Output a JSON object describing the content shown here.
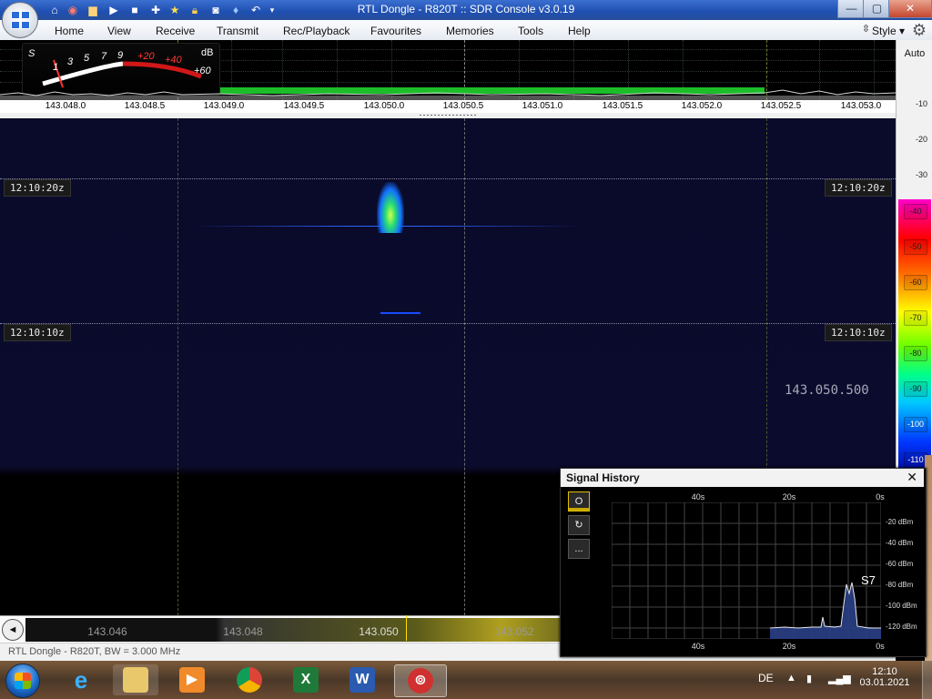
{
  "window": {
    "title": "RTL Dongle - R820T :: SDR Console v3.0.19",
    "min": "—",
    "max": "▢",
    "close": "✕"
  },
  "quick_access": [
    "home-icon",
    "lifebuoy-icon",
    "folder-icon",
    "play-icon",
    "stop-icon",
    "plus-icon",
    "star-icon",
    "lock-icon",
    "camera-icon",
    "drop-icon",
    "undo-icon",
    "dropdown-icon"
  ],
  "menu": {
    "items": [
      "Home",
      "View",
      "Receive",
      "Transmit",
      "Rec/Playback",
      "Favourites",
      "Memories",
      "Tools",
      "Help"
    ],
    "style": "Style"
  },
  "smeter": {
    "labels": [
      "S",
      "1",
      "3",
      "5",
      "7",
      "9",
      "+20",
      "+40",
      "+60",
      "dB"
    ]
  },
  "spectrum": {
    "freq_ticks": [
      "143.048.0",
      "143.048.5",
      "143.049.0",
      "143.049.5",
      "143.050.0",
      "143.050.5",
      "143.051.0",
      "143.051.5",
      "143.052.0",
      "143.052.5",
      "143.053.0"
    ]
  },
  "db_scale": {
    "auto": "Auto",
    "ticks": [
      "-10",
      "-20",
      "-30"
    ],
    "color_ticks": [
      "-40",
      "-50",
      "-60",
      "-70",
      "-80",
      "-90",
      "-100",
      "-110"
    ]
  },
  "waterfall": {
    "timestamps": [
      "12:10:20z",
      "12:10:10z"
    ],
    "center_freq": "143.050.500"
  },
  "bottom_scale": {
    "labels": [
      "143.046",
      "143.048",
      "143.050",
      "143.052"
    ]
  },
  "status": {
    "text": "RTL Dongle - R820T, BW = 3.000 MHz"
  },
  "signal_history": {
    "title": "Signal History",
    "close": "✕",
    "buttons": [
      "O",
      "↻",
      "..."
    ],
    "x_labels": [
      "40s",
      "20s",
      "0s"
    ],
    "y_labels": [
      "-20 dBm",
      "-40 dBm",
      "-60 dBm",
      "-80 dBm",
      "-100 dBm",
      "-120 dBm"
    ],
    "smeter_reading": "S7"
  },
  "taskbar": {
    "apps": [
      "internet-explorer-icon",
      "file-explorer-icon",
      "media-player-icon",
      "chrome-icon",
      "excel-icon",
      "word-icon",
      "sdr-console-icon"
    ],
    "lang": "DE",
    "time": "12:10",
    "date": "03.01.2021"
  }
}
